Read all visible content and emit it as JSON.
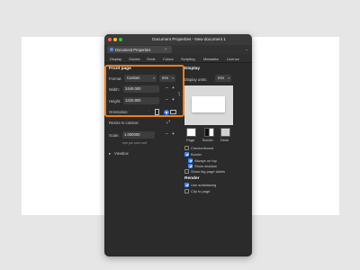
{
  "window": {
    "title": "Document Properties - New document 1"
  },
  "doc_tab": {
    "label": "Document Properties",
    "close": "×"
  },
  "tabbar_chevron": "⌄",
  "nav_tabs": [
    "Display",
    "Guides",
    "Grids",
    "Colour",
    "Scripting",
    "Metadata",
    "Licence"
  ],
  "front_page": {
    "title": "Front page",
    "format_label": "Format:",
    "format_value": "Custom",
    "unit_value": "mm",
    "width_label": "Width:",
    "width_value": "2440.000",
    "height_label": "Height:",
    "height_value": "1220.800",
    "orientation_label": "Orientation:",
    "minus": "−",
    "plus": "+"
  },
  "resize_to_content": {
    "label": "Resize to content:"
  },
  "scale": {
    "label": "Scale:",
    "value": "1.000000",
    "subtext": "mm per user unit"
  },
  "viewbox": {
    "label": "Viewbox"
  },
  "display": {
    "title": "Display",
    "units_label": "Display units:",
    "units_value": "mm",
    "swatch_labels": [
      "Page",
      "Border",
      "Desk"
    ],
    "checkerboard": "Checkerboard",
    "border": "Border",
    "always_on_top": "Always on top",
    "show_shadow": "Show shadow",
    "show_page_labels": "Show big page labels"
  },
  "render": {
    "title": "Render",
    "use_antialiasing": "Use antialiasing",
    "clip_to_page": "Clip to page"
  },
  "colors": {
    "highlight": "#f07d1b",
    "accent": "#3b82f6",
    "window_bg": "#2b2b2b"
  }
}
